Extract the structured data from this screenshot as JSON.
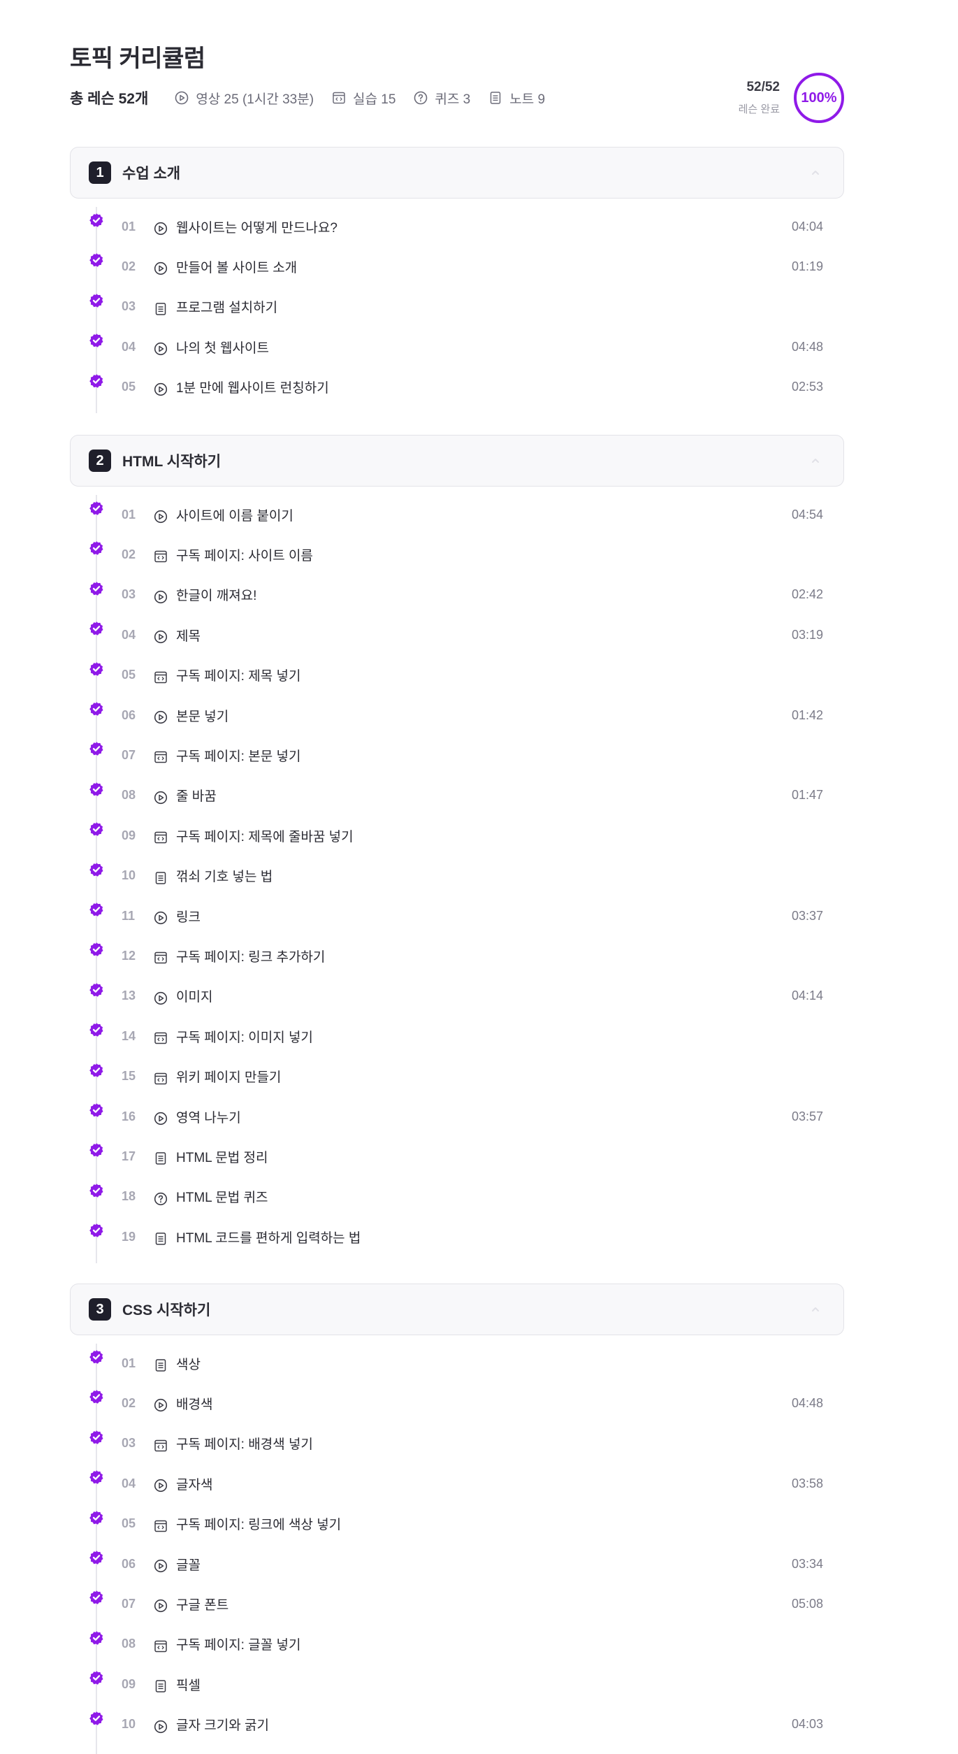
{
  "header": {
    "title": "토픽 커리큘럼",
    "total_lessons": "총 레슨 52개",
    "stats": [
      {
        "icon": "play-circle-icon",
        "label": "영상 25 (1시간 33분)"
      },
      {
        "icon": "code-window-icon",
        "label": "실습 15"
      },
      {
        "icon": "question-circle-icon",
        "label": "퀴즈 3"
      },
      {
        "icon": "note-document-icon",
        "label": "노트 9"
      }
    ],
    "progress": {
      "count": "52/52",
      "label": "레슨 완료",
      "percent_text": "100%",
      "fraction": 1.0
    }
  },
  "colors": {
    "accent": "#8f1ae8",
    "badge": "#1f1f2b",
    "muted": "#a7a7b3"
  },
  "sections": [
    {
      "number": "1",
      "title": "수업 소개",
      "lessons": [
        {
          "num": "01",
          "type": "video",
          "title": "웹사이트는 어떻게 만드나요?",
          "duration": "04:04"
        },
        {
          "num": "02",
          "type": "video",
          "title": "만들어 볼 사이트 소개",
          "duration": "01:19"
        },
        {
          "num": "03",
          "type": "note",
          "title": "프로그램 설치하기",
          "duration": ""
        },
        {
          "num": "04",
          "type": "video",
          "title": "나의 첫 웹사이트",
          "duration": "04:48"
        },
        {
          "num": "05",
          "type": "video",
          "title": "1분 만에 웹사이트 런칭하기",
          "duration": "02:53"
        }
      ]
    },
    {
      "number": "2",
      "title": "HTML 시작하기",
      "lessons": [
        {
          "num": "01",
          "type": "video",
          "title": "사이트에 이름 붙이기",
          "duration": "04:54"
        },
        {
          "num": "02",
          "type": "code",
          "title": "구독 페이지: 사이트 이름",
          "duration": ""
        },
        {
          "num": "03",
          "type": "video",
          "title": "한글이 깨져요!",
          "duration": "02:42"
        },
        {
          "num": "04",
          "type": "video",
          "title": "제목",
          "duration": "03:19"
        },
        {
          "num": "05",
          "type": "code",
          "title": "구독 페이지: 제목 넣기",
          "duration": ""
        },
        {
          "num": "06",
          "type": "video",
          "title": "본문 넣기",
          "duration": "01:42"
        },
        {
          "num": "07",
          "type": "code",
          "title": "구독 페이지: 본문 넣기",
          "duration": ""
        },
        {
          "num": "08",
          "type": "video",
          "title": "줄 바꿈",
          "duration": "01:47"
        },
        {
          "num": "09",
          "type": "code",
          "title": "구독 페이지: 제목에 줄바꿈 넣기",
          "duration": ""
        },
        {
          "num": "10",
          "type": "note",
          "title": "꺾쇠 기호 넣는 법",
          "duration": ""
        },
        {
          "num": "11",
          "type": "video",
          "title": "링크",
          "duration": "03:37"
        },
        {
          "num": "12",
          "type": "code",
          "title": "구독 페이지: 링크 추가하기",
          "duration": ""
        },
        {
          "num": "13",
          "type": "video",
          "title": "이미지",
          "duration": "04:14"
        },
        {
          "num": "14",
          "type": "code",
          "title": "구독 페이지: 이미지 넣기",
          "duration": ""
        },
        {
          "num": "15",
          "type": "code",
          "title": "위키 페이지 만들기",
          "duration": ""
        },
        {
          "num": "16",
          "type": "video",
          "title": "영역 나누기",
          "duration": "03:57"
        },
        {
          "num": "17",
          "type": "note",
          "title": "HTML 문법 정리",
          "duration": ""
        },
        {
          "num": "18",
          "type": "quiz",
          "title": "HTML 문법 퀴즈",
          "duration": ""
        },
        {
          "num": "19",
          "type": "note",
          "title": "HTML 코드를 편하게 입력하는 법",
          "duration": ""
        }
      ]
    },
    {
      "number": "3",
      "title": "CSS 시작하기",
      "lessons": [
        {
          "num": "01",
          "type": "note",
          "title": "색상",
          "duration": ""
        },
        {
          "num": "02",
          "type": "video",
          "title": "배경색",
          "duration": "04:48"
        },
        {
          "num": "03",
          "type": "code",
          "title": "구독 페이지: 배경색 넣기",
          "duration": ""
        },
        {
          "num": "04",
          "type": "video",
          "title": "글자색",
          "duration": "03:58"
        },
        {
          "num": "05",
          "type": "code",
          "title": "구독 페이지: 링크에 색상 넣기",
          "duration": ""
        },
        {
          "num": "06",
          "type": "video",
          "title": "글꼴",
          "duration": "03:34"
        },
        {
          "num": "07",
          "type": "video",
          "title": "구글 폰트",
          "duration": "05:08"
        },
        {
          "num": "08",
          "type": "code",
          "title": "구독 페이지: 글꼴 넣기",
          "duration": ""
        },
        {
          "num": "09",
          "type": "note",
          "title": "픽셀",
          "duration": ""
        },
        {
          "num": "10",
          "type": "video",
          "title": "글자 크기와 굵기",
          "duration": "04:03"
        }
      ]
    }
  ]
}
